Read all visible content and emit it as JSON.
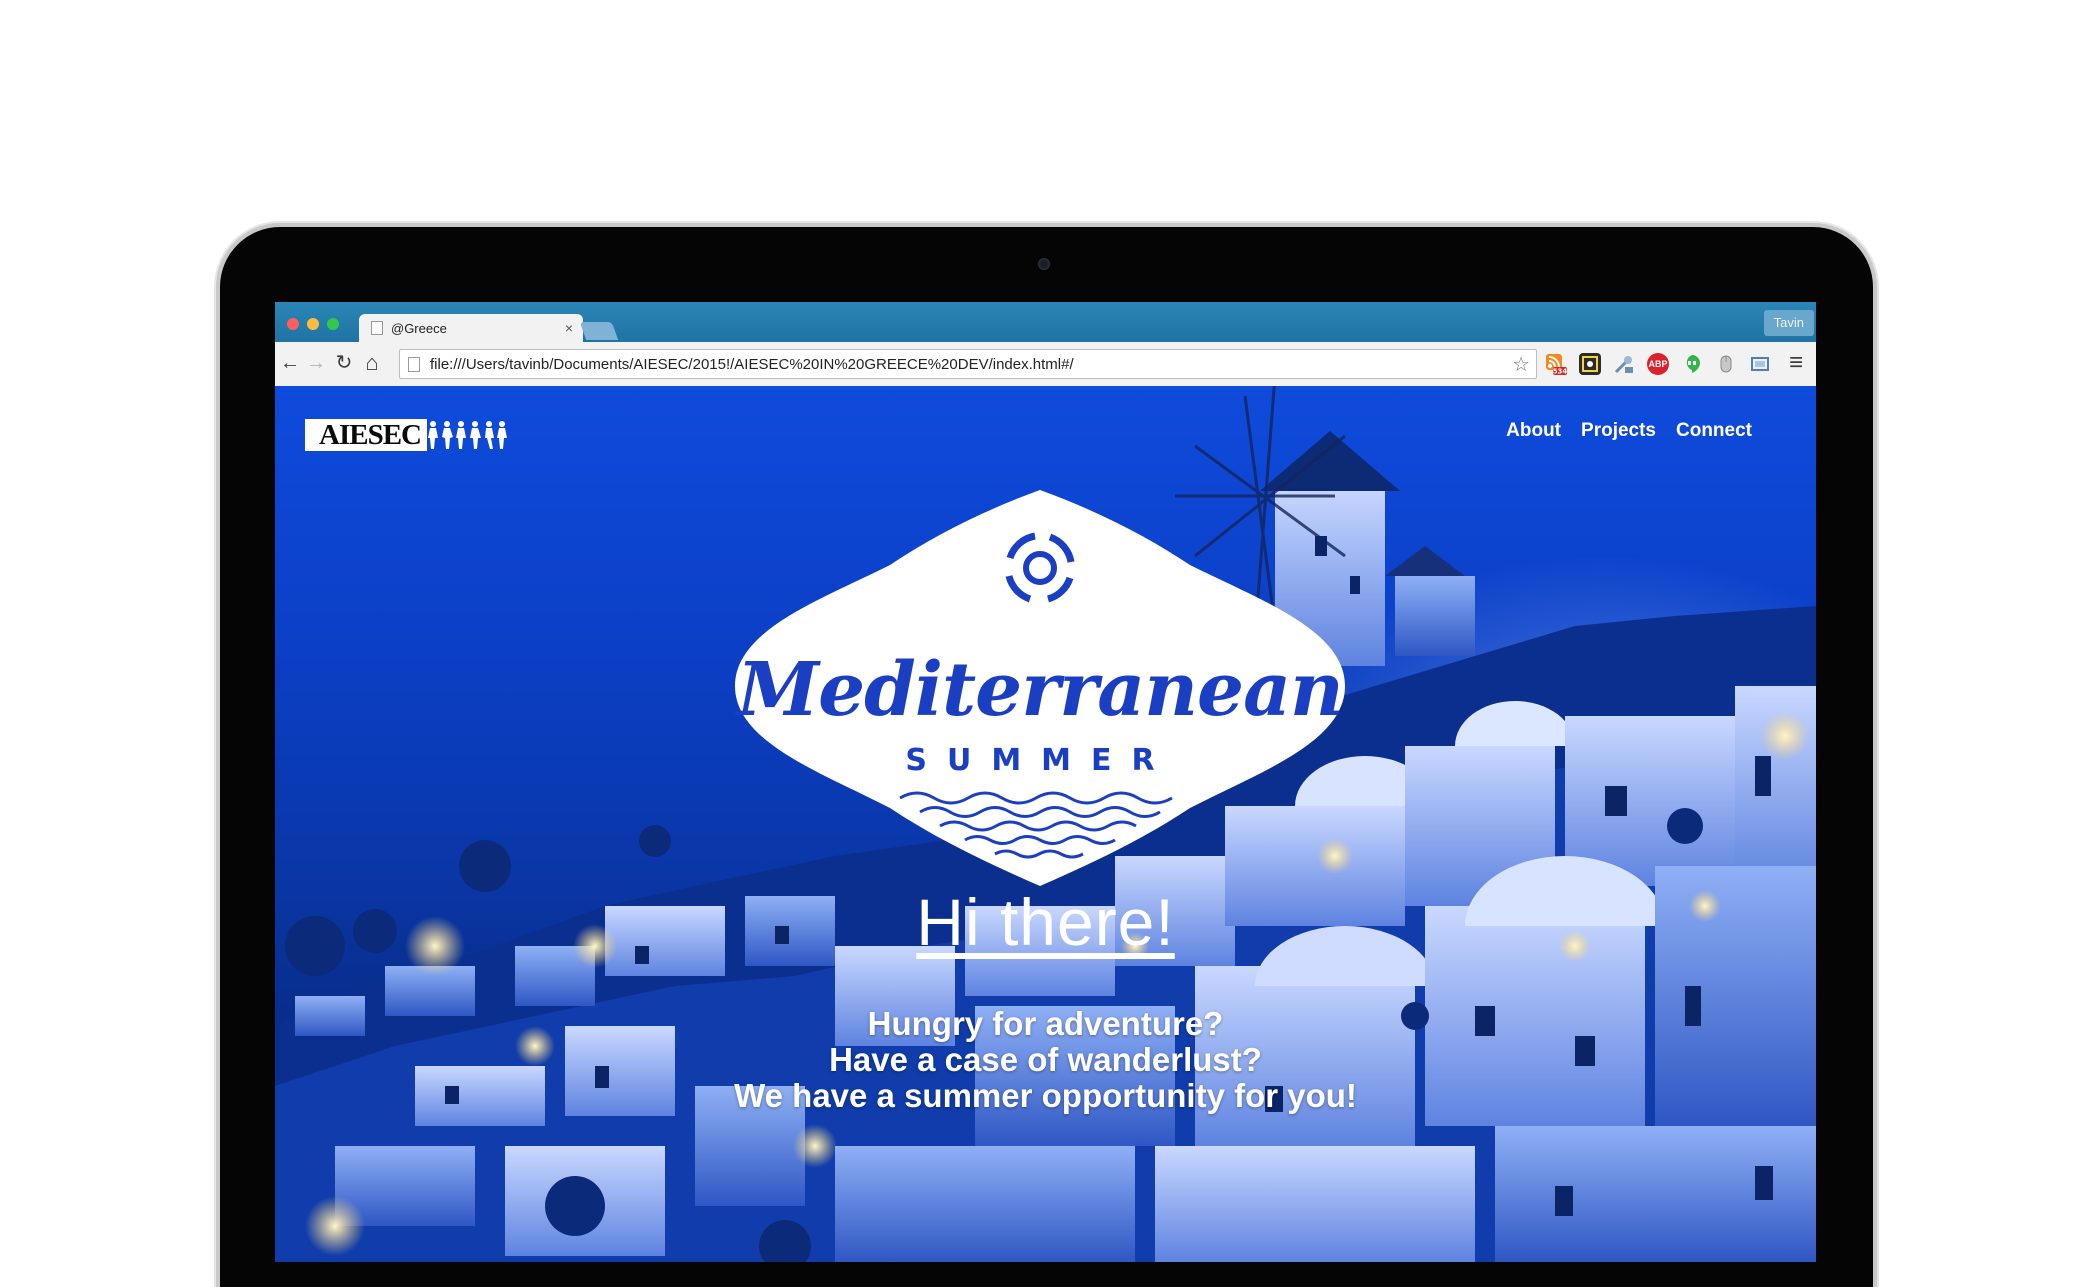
{
  "browser": {
    "tab_title": "@Greece",
    "tab_close": "×",
    "profile_name": "Tavin",
    "url": "file:///Users/tavinb/Documents/AIESEC/2015!/AIESEC%20IN%20GREECE%20DEV/index.html#/",
    "nav_icons": {
      "back": "←",
      "forward": "→",
      "reload": "↻",
      "home": "⌂",
      "star": "☆",
      "menu": "≡"
    },
    "extensions": [
      {
        "name": "rss-feed-icon",
        "label": "",
        "badge": "534",
        "color": "#f28a1e"
      },
      {
        "name": "screenshot-icon",
        "label": "",
        "color": "#2b2b2b"
      },
      {
        "name": "tools-icon",
        "label": "",
        "color": "#6b8fb3"
      },
      {
        "name": "adblock-icon",
        "label": "ABP",
        "color": "#d9222a"
      },
      {
        "name": "hangouts-icon",
        "label": "",
        "color": "#2fb64a"
      },
      {
        "name": "mouse-icon",
        "label": "",
        "color": "#9c9c9c"
      },
      {
        "name": "cast-icon",
        "label": "",
        "color": "#4a7fc2"
      }
    ]
  },
  "site": {
    "logo_text": "AIESEC",
    "nav": [
      "About",
      "Projects",
      "Connect"
    ],
    "badge": {
      "script_text": "Mediterranean",
      "word": "SUMMER",
      "color": "#1b3fc2"
    },
    "headline": "Hi there!",
    "tagline": [
      "Hungry for adventure?",
      "Have a case of wanderlust?",
      "We have a summer opportunity for you!"
    ]
  },
  "colors": {
    "sky_top": "#0f4bdc",
    "sky_bottom": "#061f5f",
    "tabstrip": "#2b86b5",
    "brand_blue": "#1b3fc2"
  }
}
